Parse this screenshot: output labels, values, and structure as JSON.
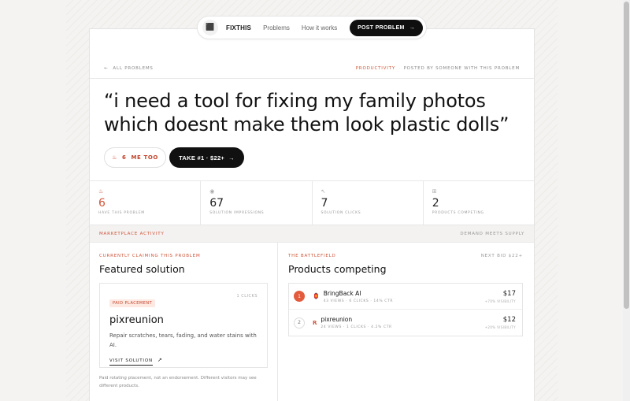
{
  "nav": {
    "logo_icon": "fixthis-logo-icon",
    "brand": "FIXTHIS",
    "links": [
      "Problems",
      "How it works"
    ],
    "cta": "POST PROBLEM",
    "cta_icon": "arrow-right-icon"
  },
  "breadcrumb": {
    "back": "ALL PROBLEMS",
    "category": "PRODUCTIVITY",
    "separator": "·",
    "posted_by": "POSTED BY SOMEONE WITH THIS PROBLEM"
  },
  "problem": {
    "quote": "“i need a tool for fixing my family photos which doesnt make them look plastic dolls”"
  },
  "actions": {
    "metoo_count": "6",
    "metoo_label": "ME TOO",
    "take_label": "TAKE #1 · $22+"
  },
  "stats": [
    {
      "icon": "flame-icon",
      "icon_glyph": "♨",
      "value": "6",
      "label": "HAVE THIS PROBLEM"
    },
    {
      "icon": "eye-icon",
      "icon_glyph": "◉",
      "value": "67",
      "label": "SOLUTION IMPRESSIONS"
    },
    {
      "icon": "cursor-icon",
      "icon_glyph": "↖",
      "value": "7",
      "label": "SOLUTION CLICKS"
    },
    {
      "icon": "chart-icon",
      "icon_glyph": "⊞",
      "value": "2",
      "label": "PRODUCTS COMPETING"
    }
  ],
  "activity": {
    "left": "MARKETPLACE ACTIVITY",
    "right": "DEMAND MEETS SUPPLY"
  },
  "featured": {
    "eyebrow": "CURRENTLY CLAIMING THIS PROBLEM",
    "title": "Featured solution",
    "badge": "PAID PLACEMENT",
    "clicks": "1 CLICKS",
    "name": "pixreunion",
    "description": "Repair scratches, tears, fading, and water stains with AI.",
    "visit": "VISIT SOLUTION",
    "footnote": "Paid rotating placement, not an endorsement. Different visitors may see different products."
  },
  "battlefield": {
    "eyebrow": "THE BATTLEFIELD",
    "next_bid": "NEXT BID $22+",
    "title": "Products competing",
    "products": [
      {
        "rank": "1",
        "icon": "bringback-logo-icon",
        "name": "BringBack AI",
        "meta": "43 VIEWS · 6 CLICKS · 14% CTR",
        "price": "$17",
        "visibility": "+70% VISIBILITY"
      },
      {
        "rank": "2",
        "icon": "pixreunion-logo-icon",
        "name": "pixreunion",
        "meta": "24 VIEWS · 1 CLICKS · 4.2% CTR",
        "price": "$12",
        "visibility": "+20% VISIBILITY"
      }
    ]
  },
  "colors": {
    "accent": "#d0553a",
    "dark": "#111111",
    "badge_bg": "#fde9e2"
  }
}
